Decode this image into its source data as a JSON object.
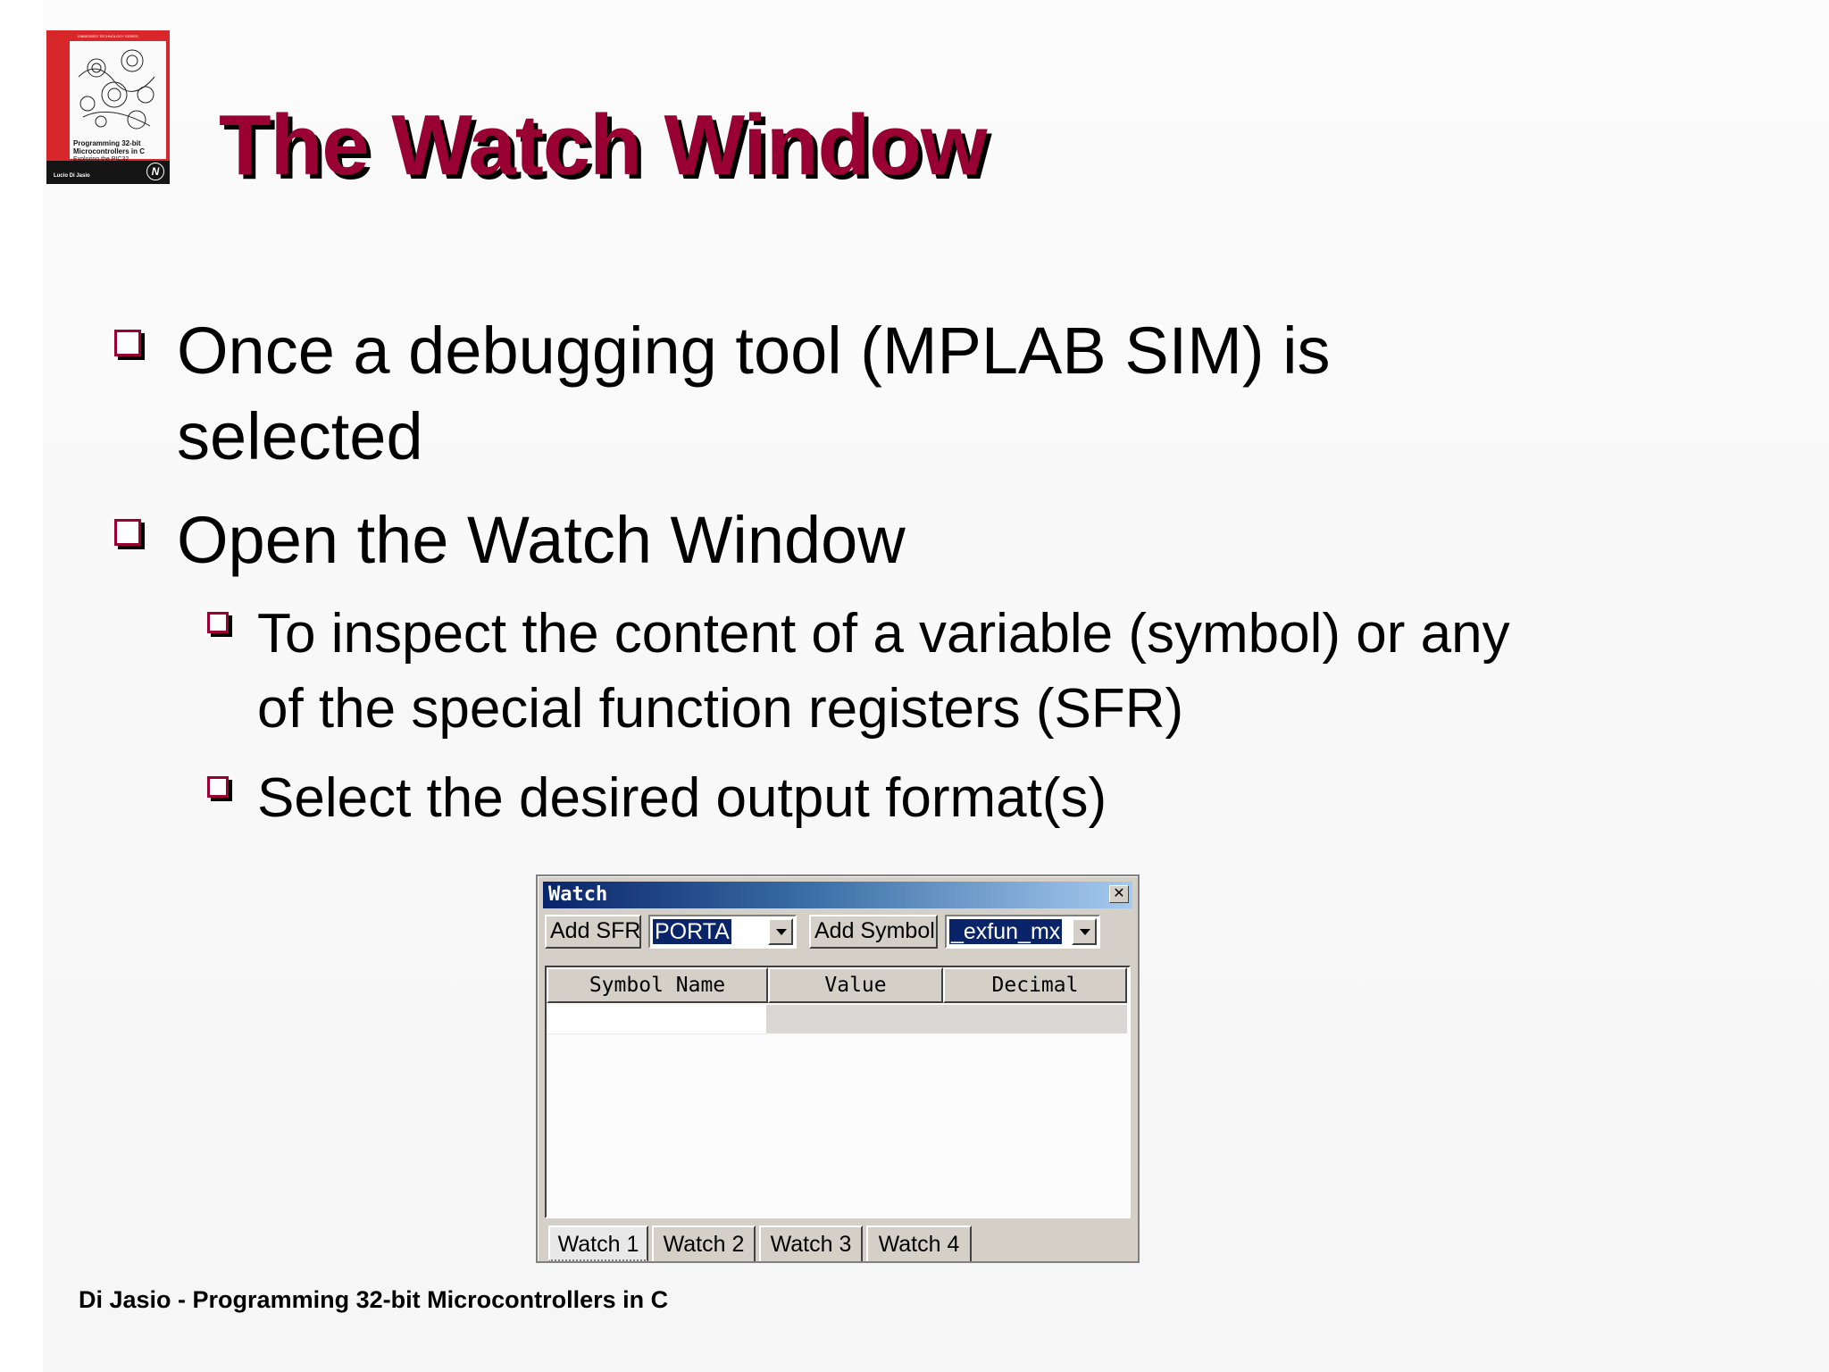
{
  "cover": {
    "series": "EMBEDDED TECHNOLOGY SERIES",
    "title": "Programming 32-bit Microcontrollers in C",
    "subtitle": "Exploring the PIC32",
    "author": "Lucio Di Jasio",
    "logo": "N"
  },
  "title": "The Watch Window",
  "bullets": [
    {
      "level": 1,
      "text": "Once a debugging tool (MPLAB SIM) is\nselected"
    },
    {
      "level": 1,
      "text": "Open the Watch Window"
    },
    {
      "level": 2,
      "text": "To inspect the content of a variable (symbol) or any\nof the special function registers (SFR)"
    },
    {
      "level": 2,
      "text": "Select the desired output format(s)"
    }
  ],
  "watch": {
    "title": "Watch",
    "close_icon": "close-icon",
    "add_sfr_label": "Add SFR",
    "sfr_value": "PORTA",
    "add_symbol_label": "Add Symbol",
    "symbol_value": "_exfun_mx",
    "columns": [
      "Symbol Name",
      "Value",
      "Decimal"
    ],
    "tabs": [
      "Watch 1",
      "Watch 2",
      "Watch 3",
      "Watch 4"
    ],
    "active_tab": "Watch 1"
  },
  "footer": "Di Jasio - Programming 32-bit Microcontrollers in C",
  "colors": {
    "title": "#990033",
    "bullet_box": "#990033",
    "titlebar_start": "#0a246a",
    "titlebar_end": "#a6caf0"
  }
}
